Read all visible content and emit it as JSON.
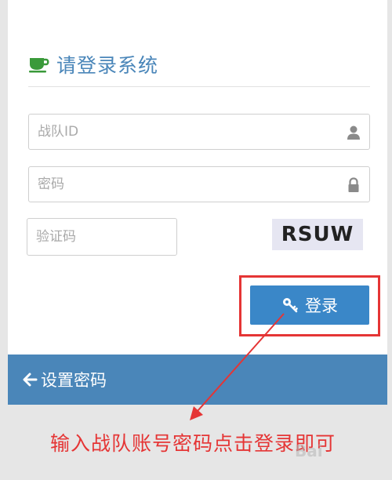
{
  "header": {
    "title": "请登录系统",
    "icon": "coffee-cup-icon"
  },
  "form": {
    "team_id": {
      "placeholder": "战队ID",
      "value": "",
      "icon": "user-icon"
    },
    "password": {
      "placeholder": "密码",
      "value": "",
      "icon": "lock-icon"
    },
    "captcha": {
      "placeholder": "验证码",
      "value": "",
      "image_text": "RSUW"
    },
    "login_button": {
      "label": "登录",
      "icon": "key-icon"
    }
  },
  "footer": {
    "set_password_label": "设置密码",
    "icon": "arrow-left-icon"
  },
  "annotation": {
    "text": "输入战队账号密码点击登录即可"
  },
  "watermark": {
    "text": "Bai"
  },
  "colors": {
    "accent": "#4a86b9",
    "button": "#3a87c8",
    "annotation": "#e53535"
  }
}
